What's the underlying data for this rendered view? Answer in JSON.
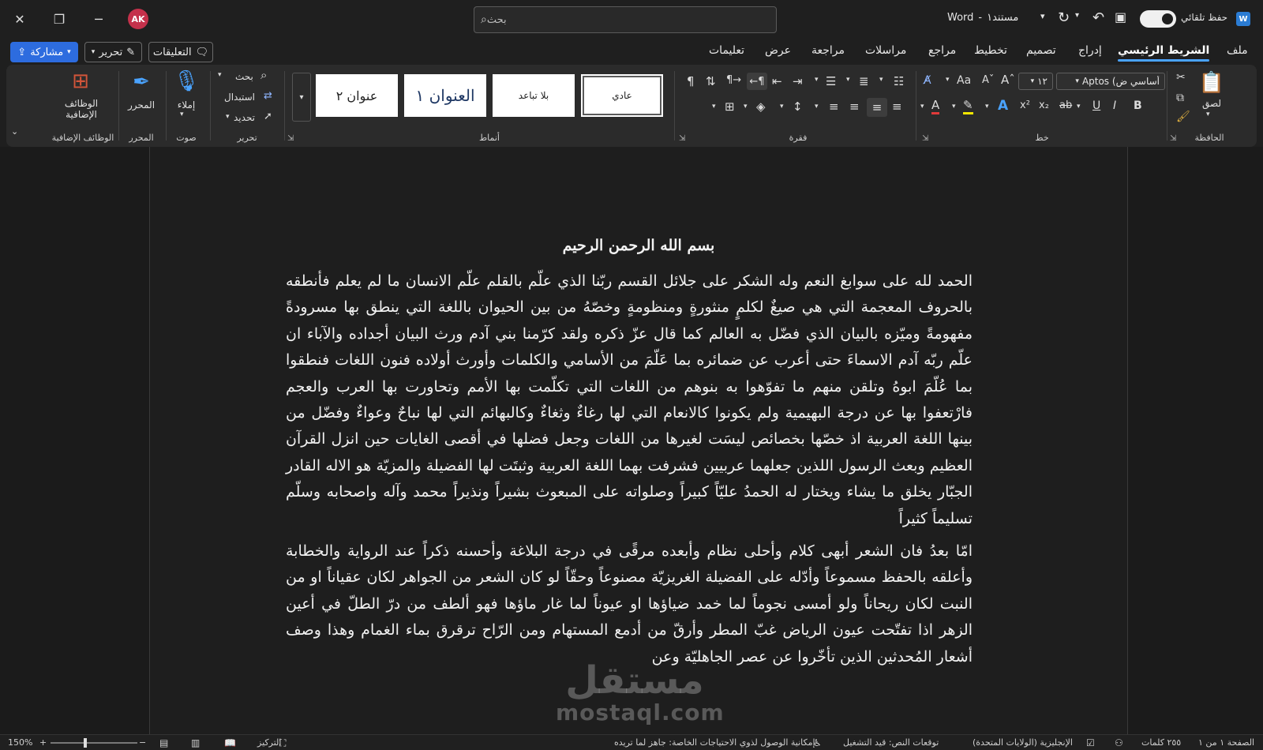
{
  "titlebar": {
    "doc_name": "مستند١",
    "separator": "-",
    "app_name": "Word",
    "autosave_label": "حفظ تلقائي",
    "search_placeholder": "بحث",
    "avatar_initials": "AK"
  },
  "tabs": [
    {
      "label": "ملف"
    },
    {
      "label": "الشريط الرئيسي"
    },
    {
      "label": "إدراج"
    },
    {
      "label": "تصميم"
    },
    {
      "label": "تخطيط"
    },
    {
      "label": "مراجع"
    },
    {
      "label": "مراسلات"
    },
    {
      "label": "مراجعة"
    },
    {
      "label": "عرض"
    },
    {
      "label": "تعليمات"
    }
  ],
  "menu_buttons": {
    "comments": "التعليقات",
    "editing": "تحرير",
    "share": "مشاركة"
  },
  "ribbon": {
    "clipboard": {
      "group": "الحافظة",
      "paste": "لصق"
    },
    "font": {
      "group": "خط",
      "font_name": "Aptos (أساسي ض",
      "font_size": "١٢"
    },
    "paragraph": {
      "group": "فقرة"
    },
    "styles": {
      "group": "أنماط",
      "items": [
        {
          "label": "عادي"
        },
        {
          "label": "بلا تباعد"
        },
        {
          "label": "العنوان ١"
        },
        {
          "label": "عنوان ٢"
        }
      ]
    },
    "editing": {
      "group": "تحرير",
      "find": "بحث",
      "replace": "استبدال",
      "select": "تحديد"
    },
    "voice": {
      "group": "صوت",
      "dictate": "إملاء"
    },
    "editor": {
      "group": "المحرر",
      "label": "المحرر"
    },
    "addins": {
      "group": "الوظائف الإضافية",
      "label": "الوظائف الإضافية"
    }
  },
  "document": {
    "title": "بسم الله الرحمن الرحيم",
    "paragraphs": [
      "الحمد لله على سوابغ النعم وله الشكر على جلائل القسم ربّنا الذي علّم بالقلم علّم الانسان ما لم يعلم فأنطقه بالحروف المعجمة التي هي صيغٌ لكلمٍ منثورةٍ ومنظومةٍ وخصّهُ من بين الحيوان باللغة التي ينطق بها مسرودةً مفهومةً وميّزه بالبيان الذي فضّل به العالم كما قال عزّ ذكره ولقد كرّمنا بني آدم ورث البيان أجداده والآباء ان علّم ربّه آدم الاسماءَ حتى أعرب عن ضمائره بما عَلّمَ من الأسامي والكلمات وأورث أولاده فنون اللغات فنطقوا بما عُلّمَ ابوهُ وتلقن منهم ما تفوّهوا به بنوهم من اللغات التي تكلّمت بها الأمم وتحاورت بها العرب والعجم فارْتعفوا بها عن درجة البهيمية ولم يكونوا كالانعام التي لها رغاءٌ وثغاءٌ وكالبهائم التي لها نباحٌ وعواءٌ وفضّل من بينها اللغة العربية اذ خصّها بخصائص ليسَت لغيرها من اللغات وجعل فضلها في أقصى الغايات حين انزل القرآن العظيم وبعث الرسول اللذين جعلهما عربيين فشرفت بهما اللغة العربية وثبتَت لها الفضيلة والمزيّة هو الاله القادر الجبّار يخلق ما يشاء ويختار له الحمدُ عليّاً كبيراً وصلواته على المبعوث بشيراً ونذيراً محمد وآله واصحابه وسلّم تسليماً كثيراً",
      "امّا بعدُ فان الشعر أبهى كلام وأحلى نظام وأبعده مرقًى في درجة البلاغة وأحسنه ذكراً عند الرواية والخطابة وأعلقه بالحفظ مسموعاً وأدّله على الفضيلة الغريزيّة مصنوعاً وحقّاً لو كان الشعر من الجواهر لكان عقياناً او من النبت لكان ريحاناً ولو أمسى نجوماً لما خمد ضياؤها او عيوناً لما غار ماؤها فهو ألطف من درّ الطلّ في أعين الزهر اذا تفتّحت عيون الرياض غبّ المطر وأرقّ من أدمع المستهام ومن الرّاح ترقرق بماء الغمام وهذا وصف أشعار المُحدثين الذين تأخّروا عن عصر الجاهليّة وعن"
    ]
  },
  "watermark": {
    "logo": "مستقل",
    "text": "mostaql.com"
  },
  "statusbar": {
    "page": "الصفحة ١ من ١",
    "words": "٢٥٥ كلمات",
    "language": "الإنجليزية (الولايات المتحدة)",
    "predictions": "توقعات النص: قيد التشغيل",
    "accessibility": "إمكانية الوصول لذوي الاحتياجات الخاصة: جاهز لما تريده",
    "focus": "التركيز",
    "zoom": "150%"
  }
}
